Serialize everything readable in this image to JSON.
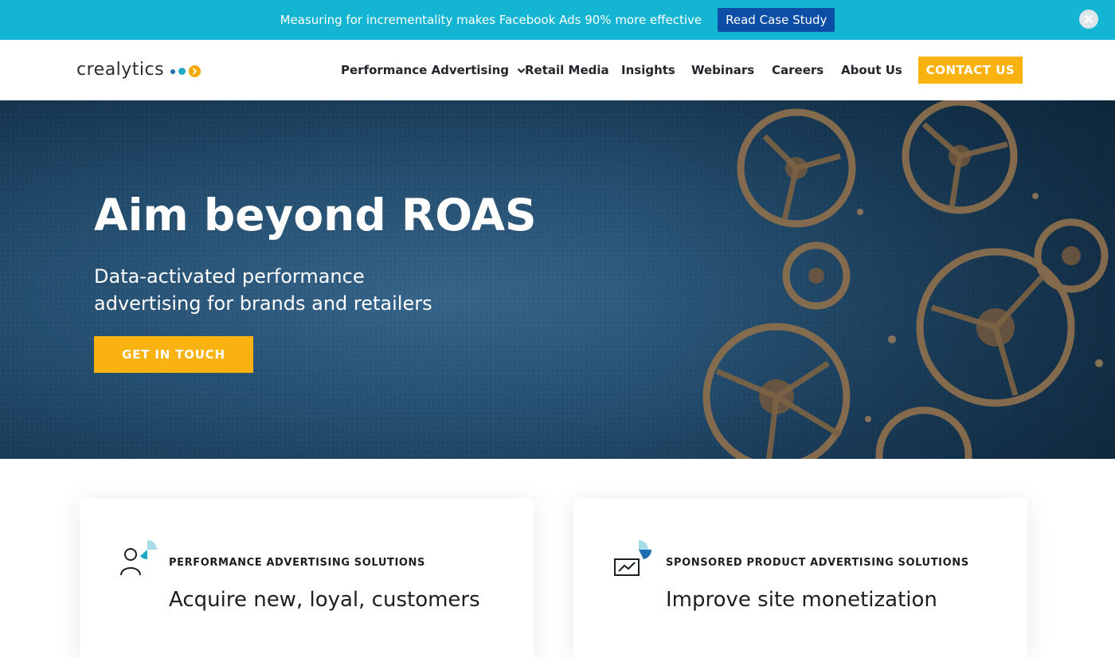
{
  "announcement": {
    "message": "Measuring for incrementality makes Facebook Ads 90% more effective",
    "button_label": "Read Case Study",
    "close_icon": "close-icon"
  },
  "nav": {
    "logo_text": "crealytics",
    "items": [
      {
        "label": "Performance Advertising",
        "has_dropdown": true
      },
      {
        "label": "Retail Media"
      },
      {
        "label": "Insights"
      },
      {
        "label": "Webinars"
      },
      {
        "label": "Careers"
      },
      {
        "label": "About Us"
      }
    ],
    "contact_label": "CONTACT US"
  },
  "hero": {
    "title": "Aim beyond ROAS",
    "subtitle": "Data-activated performance advertising for brands and retailers",
    "cta_label": "GET IN TOUCH"
  },
  "cards": [
    {
      "kicker": "PERFORMANCE ADVERTISING SOLUTIONS",
      "title": "Acquire new, loyal, customers",
      "icon": "customer-icon"
    },
    {
      "kicker": "SPONSORED PRODUCT ADVERTISING SOLUTIONS",
      "title": "Improve site monetization",
      "icon": "chart-icon"
    }
  ],
  "colors": {
    "announcement_bg": "#13b5d2",
    "announcement_button": "#0c4ea6",
    "accent_yellow": "#f9b210",
    "hero_blue": "#244d6e",
    "icon_teal": "#20a8c7"
  }
}
